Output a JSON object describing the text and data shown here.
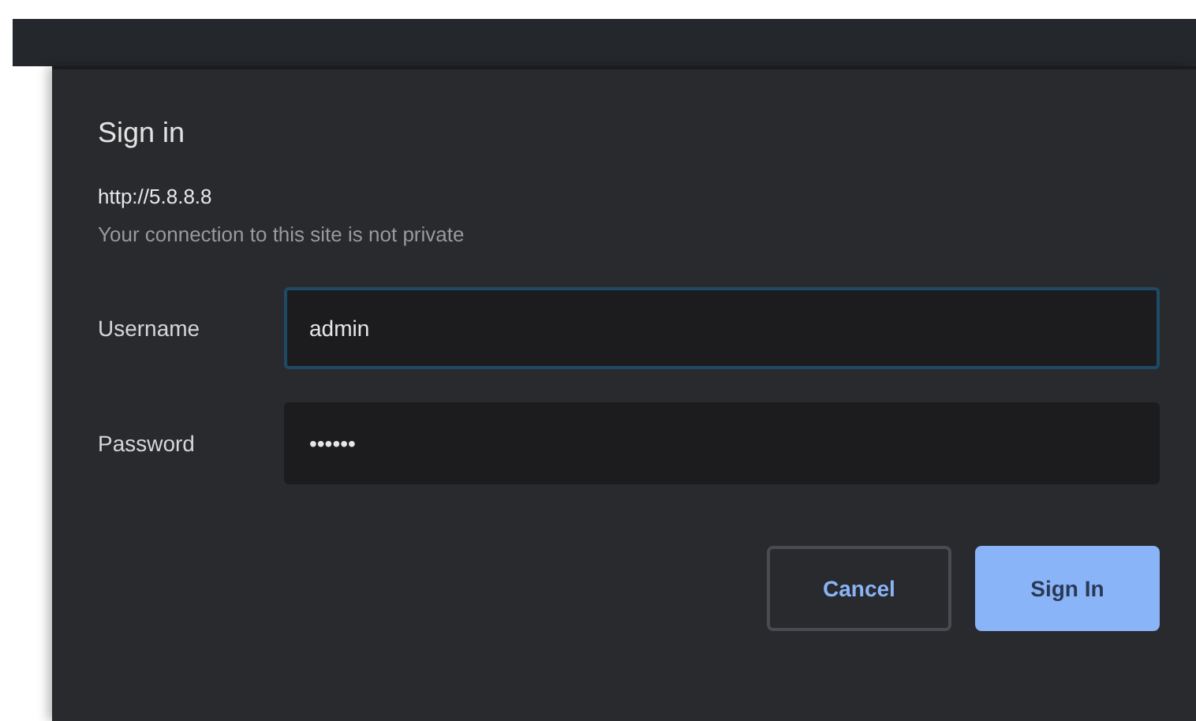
{
  "dialog": {
    "title": "Sign in",
    "url": "http://5.8.8.8",
    "note": "Your connection to this site is not private",
    "fields": [
      {
        "label": "Username",
        "value": "admin",
        "focused": true
      },
      {
        "label": "Password",
        "value": "••••••",
        "focused": false
      }
    ],
    "buttons": [
      {
        "label": "Cancel",
        "kind": "secondary"
      },
      {
        "label": "Sign In",
        "kind": "primary"
      }
    ]
  }
}
